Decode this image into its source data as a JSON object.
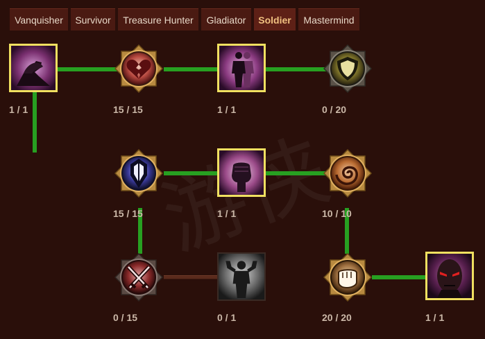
{
  "tabs": [
    {
      "label": "Vanquisher",
      "active": false
    },
    {
      "label": "Survivor",
      "active": false
    },
    {
      "label": "Treasure Hunter",
      "active": false
    },
    {
      "label": "Gladiator",
      "active": false
    },
    {
      "label": "Soldier",
      "active": true
    },
    {
      "label": "Mastermind",
      "active": false
    }
  ],
  "nodes": [
    {
      "id": "arm-wrestle",
      "count": "1 / 1",
      "icon": "arm-wrestle-icon",
      "shape": "square"
    },
    {
      "id": "broken-heart",
      "count": "15 / 15",
      "icon": "broken-heart-icon",
      "shape": "round"
    },
    {
      "id": "twin-figures",
      "count": "1 / 1",
      "icon": "twin-figures-icon",
      "shape": "square"
    },
    {
      "id": "shield",
      "count": "0 / 20",
      "icon": "shield-icon",
      "shape": "round"
    },
    {
      "id": "blade-emblem",
      "count": "15 / 15",
      "icon": "blade-emblem-icon",
      "shape": "round"
    },
    {
      "id": "raised-fist",
      "count": "1 / 1",
      "icon": "raised-fist-icon",
      "shape": "square"
    },
    {
      "id": "swirl",
      "count": "10 / 10",
      "icon": "swirl-icon",
      "shape": "round"
    },
    {
      "id": "crossed-swords",
      "count": "0 / 15",
      "icon": "crossed-swords-icon",
      "shape": "round"
    },
    {
      "id": "flexing-figure",
      "count": "0 / 1",
      "icon": "flexing-figure-icon",
      "shape": "square-dim"
    },
    {
      "id": "punch",
      "count": "20 / 20",
      "icon": "punch-icon",
      "shape": "round"
    },
    {
      "id": "demon-face",
      "count": "1 / 1",
      "icon": "demon-face-icon",
      "shape": "square"
    }
  ],
  "colors": {
    "background": "#2a0f0a",
    "tab_bg": "#4a1a12",
    "tab_active_text": "#f0c080",
    "link_active": "#27a021",
    "link_inactive": "#5a2a1c",
    "node_border_square": "#f0e060",
    "count_text": "#cbb8a8"
  }
}
